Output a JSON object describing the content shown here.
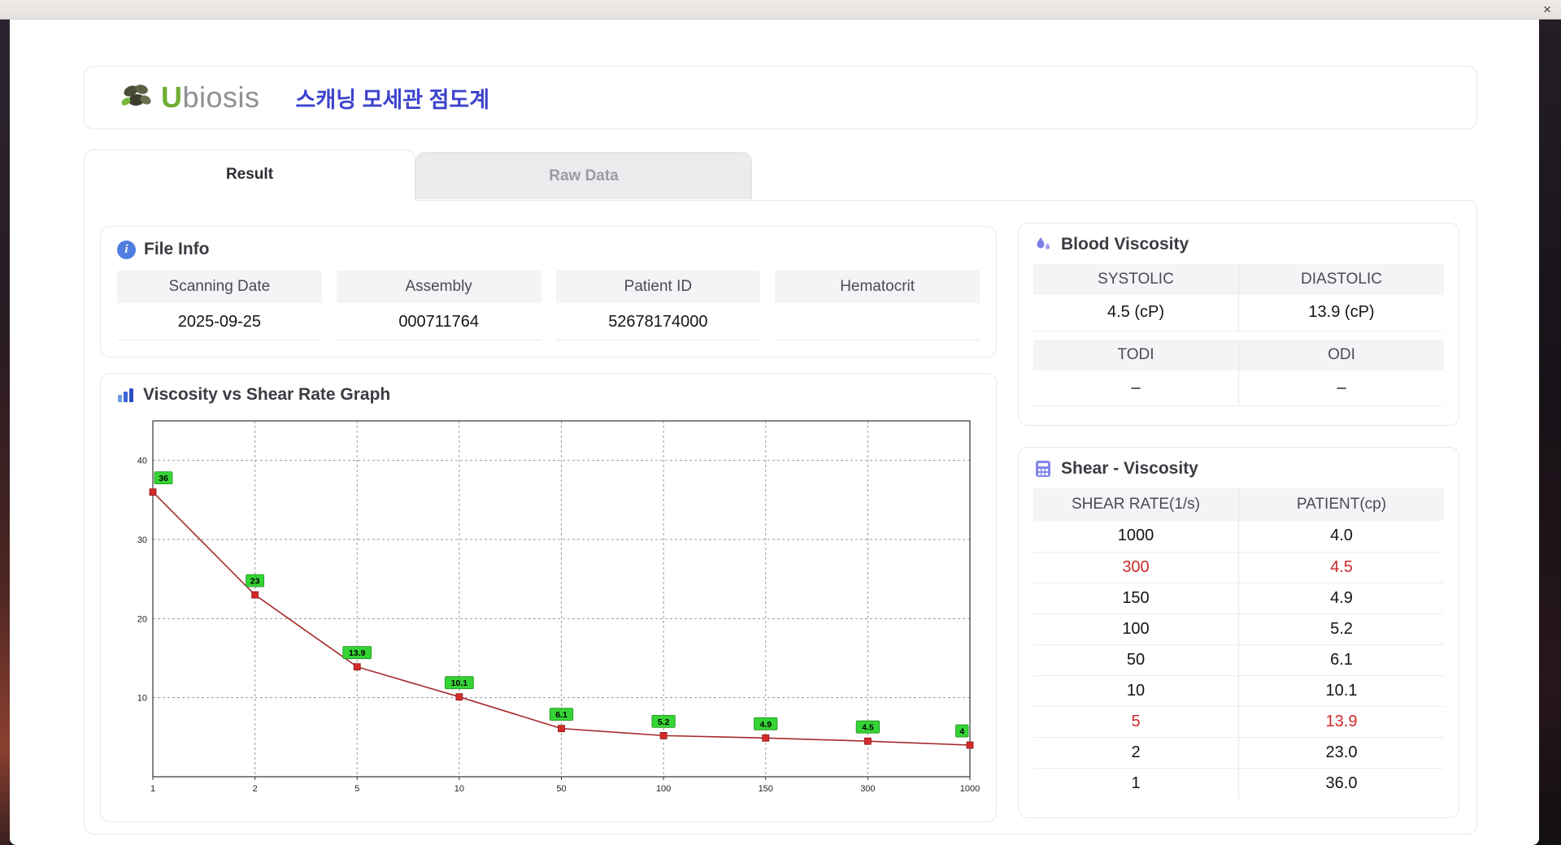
{
  "window": {
    "close": "×"
  },
  "header": {
    "logo_u": "U",
    "logo_rest": "biosis",
    "title": "스캐닝 모세관 점도계"
  },
  "tabs": {
    "result": "Result",
    "raw": "Raw Data"
  },
  "file_info": {
    "title": "File Info",
    "fields": [
      {
        "label": "Scanning Date",
        "value": "2025-09-25"
      },
      {
        "label": "Assembly",
        "value": "000711764"
      },
      {
        "label": "Patient ID",
        "value": "52678174000"
      },
      {
        "label": "Hematocrit",
        "value": ""
      }
    ]
  },
  "blood": {
    "title": "Blood Viscosity",
    "rows": [
      {
        "labels": [
          "SYSTOLIC",
          "DIASTOLIC"
        ],
        "values": [
          "4.5 (cP)",
          "13.9 (cP)"
        ]
      },
      {
        "labels": [
          "TODI",
          "ODI"
        ],
        "values": [
          "–",
          "–"
        ]
      }
    ]
  },
  "shear": {
    "title": "Shear - Viscosity",
    "columns": [
      "SHEAR RATE(1/s)",
      "PATIENT(cp)"
    ],
    "rows": [
      {
        "rate": "1000",
        "value": "4.0",
        "alert": false
      },
      {
        "rate": "300",
        "value": "4.5",
        "alert": true
      },
      {
        "rate": "150",
        "value": "4.9",
        "alert": false
      },
      {
        "rate": "100",
        "value": "5.2",
        "alert": false
      },
      {
        "rate": "50",
        "value": "6.1",
        "alert": false
      },
      {
        "rate": "10",
        "value": "10.1",
        "alert": false
      },
      {
        "rate": "5",
        "value": "13.9",
        "alert": true
      },
      {
        "rate": "2",
        "value": "23.0",
        "alert": false
      },
      {
        "rate": "1",
        "value": "36.0",
        "alert": false
      }
    ]
  },
  "graph": {
    "title": "Viscosity vs Shear Rate Graph"
  },
  "chart_data": {
    "type": "line",
    "title": "Viscosity vs Shear Rate Graph",
    "categories": [
      "1",
      "2",
      "5",
      "10",
      "50",
      "100",
      "150",
      "300",
      "1000"
    ],
    "values": [
      36,
      23,
      13.9,
      10.1,
      6.1,
      5.2,
      4.9,
      4.5,
      4
    ],
    "point_labels": [
      "36",
      "23",
      "13.9",
      "10.1",
      "6.1",
      "5.2",
      "4.9",
      "4.5",
      "4"
    ],
    "xlabel": "",
    "ylabel": "",
    "ylim": [
      0,
      45
    ],
    "yticks": [
      10,
      20,
      30,
      40
    ],
    "x_axis_scale": "category",
    "grid": true,
    "legend": false,
    "line_color": "#a52a2a",
    "marker_color": "#d42a2a",
    "point_label_bg": "#35d435"
  }
}
